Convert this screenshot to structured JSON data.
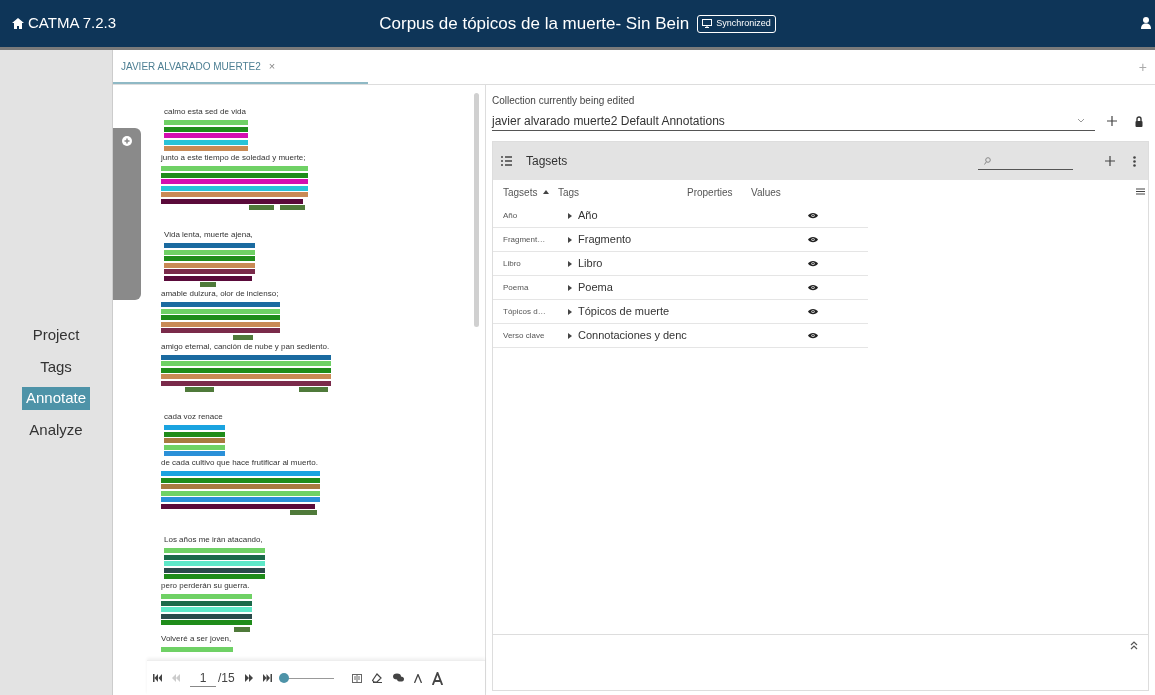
{
  "app": {
    "name": "CATMA 7.2.3",
    "project_title": "Corpus de tópicos de la muerte- Sin Bein",
    "sync_badge": "Synchronized"
  },
  "nav": [
    {
      "label": "Project",
      "selected": false
    },
    {
      "label": "Tags",
      "selected": false
    },
    {
      "label": "Annotate",
      "selected": true
    },
    {
      "label": "Analyze",
      "selected": false
    }
  ],
  "document_tab": {
    "label": "JAVIER ALVARADO MUERTE2",
    "close": "×",
    "add": "+"
  },
  "stanzas": [
    {
      "lines": [
        {
          "text": "calmo esta sed de vida",
          "layers": [
            {
              "kind": "full",
              "color": "#6fd165"
            },
            {
              "kind": "full",
              "color": "#1f8c1a"
            },
            {
              "kind": "full",
              "color": "#d40fb0"
            },
            {
              "kind": "full",
              "color": "#28c3d8"
            },
            {
              "kind": "full",
              "color": "#c98a55"
            }
          ]
        },
        {
          "text": "junto a este tiempo de soledad y muerte;",
          "layers": [
            {
              "kind": "full",
              "color": "#6fd165"
            },
            {
              "kind": "full",
              "color": "#1f8c1a"
            },
            {
              "kind": "full",
              "color": "#d40fb0"
            },
            {
              "kind": "full",
              "color": "#28c3d8"
            },
            {
              "kind": "full",
              "color": "#c98a55"
            },
            {
              "kind": "short",
              "color": "#5a0a3a"
            },
            {
              "kind": "mark-mid",
              "color": "#4f7a3a"
            },
            {
              "kind": "mark-end",
              "color": "#4f7a3a"
            }
          ]
        }
      ]
    },
    {
      "lines": [
        {
          "text": "Vida lenta, muerte ajena,",
          "layers": [
            {
              "kind": "full",
              "color": "#1a6aa0"
            },
            {
              "kind": "full",
              "color": "#6fd165"
            },
            {
              "kind": "full",
              "color": "#1f8c1a"
            },
            {
              "kind": "full",
              "color": "#c98a55"
            },
            {
              "kind": "full",
              "color": "#7a2a4a"
            },
            {
              "kind": "short",
              "color": "#5a0a3a"
            },
            {
              "kind": "mark-center",
              "color": "#4f7a3a"
            }
          ]
        },
        {
          "text": "amable dulzura, olor de incienso;",
          "layers": [
            {
              "kind": "full",
              "color": "#1a6aa0"
            },
            {
              "kind": "full",
              "color": "#6fd165"
            },
            {
              "kind": "full",
              "color": "#1f8c1a"
            },
            {
              "kind": "full",
              "color": "#c98a55"
            },
            {
              "kind": "full",
              "color": "#7a2a4a"
            },
            {
              "kind": "mark-mid",
              "color": "#4f7a3a"
            }
          ]
        },
        {
          "text": "amigo eternal, canción de nube y pan sediento.",
          "layers": [
            {
              "kind": "full",
              "color": "#1a6aa0"
            },
            {
              "kind": "full",
              "color": "#6fd165"
            },
            {
              "kind": "full",
              "color": "#1f8c1a"
            },
            {
              "kind": "full",
              "color": "#c98a55"
            },
            {
              "kind": "full",
              "color": "#7a2a4a"
            },
            {
              "kind": "mark-start",
              "color": "#4f7a3a"
            },
            {
              "kind": "mark-end",
              "color": "#4f7a3a"
            }
          ]
        }
      ]
    },
    {
      "lines": [
        {
          "text": "cada voz renace",
          "layers": [
            {
              "kind": "full",
              "color": "#1aa3e0"
            },
            {
              "kind": "full",
              "color": "#1f8c1a"
            },
            {
              "kind": "full",
              "color": "#a87a40"
            },
            {
              "kind": "full",
              "color": "#6fd165"
            },
            {
              "kind": "full",
              "color": "#2a90d8"
            }
          ]
        },
        {
          "text": "de cada cultivo que hace frutificar al muerto.",
          "layers": [
            {
              "kind": "full",
              "color": "#1aa3e0"
            },
            {
              "kind": "full",
              "color": "#1f8c1a"
            },
            {
              "kind": "full",
              "color": "#a87a40"
            },
            {
              "kind": "full",
              "color": "#6fd165"
            },
            {
              "kind": "full",
              "color": "#2a90d8"
            },
            {
              "kind": "short",
              "color": "#5a0a3a"
            },
            {
              "kind": "mark-end",
              "color": "#4f7a3a"
            }
          ]
        }
      ]
    },
    {
      "lines": [
        {
          "text": "Los años me irán atacando,",
          "layers": [
            {
              "kind": "full",
              "color": "#6fd165"
            },
            {
              "kind": "full",
              "color": "#1a6a4a"
            },
            {
              "kind": "full",
              "color": "#5ee8c8"
            },
            {
              "kind": "full",
              "color": "#2a4a4a"
            },
            {
              "kind": "full",
              "color": "#1f8c1a"
            }
          ]
        },
        {
          "text": "pero perderán su guerra.",
          "layers": [
            {
              "kind": "full",
              "color": "#6fd165"
            },
            {
              "kind": "full",
              "color": "#1a6a4a"
            },
            {
              "kind": "full",
              "color": "#5ee8c8"
            },
            {
              "kind": "full",
              "color": "#2a4a4a"
            },
            {
              "kind": "full",
              "color": "#1f8c1a"
            },
            {
              "kind": "mark-end",
              "color": "#4f7a3a"
            }
          ]
        },
        {
          "text": "Volveré a ser joven,",
          "layers": [
            {
              "kind": "full",
              "color": "#6fd165"
            }
          ]
        }
      ]
    }
  ],
  "pager": {
    "page": "1",
    "total": "/15",
    "zoom": {
      "level": 0.05
    },
    "prev_disabled": true
  },
  "collection": {
    "label": "Collection currently being edited",
    "value": "javier alvarado muerte2 Default Annotations"
  },
  "tagsets": {
    "title": "Tagsets",
    "columns": [
      "Tagsets",
      "Tags",
      "Properties",
      "Values"
    ],
    "rows": [
      {
        "tagset": "Año",
        "tag": "Año",
        "visible": true
      },
      {
        "tagset": "Fragment…",
        "tag": "Fragmento",
        "visible": true
      },
      {
        "tagset": "Libro",
        "tag": "Libro",
        "visible": true
      },
      {
        "tagset": "Poema",
        "tag": "Poema",
        "visible": true
      },
      {
        "tagset": "Tópicos d…",
        "tag": "Tópicos de muerte",
        "visible": true
      },
      {
        "tagset": "Verso clave",
        "tag": "Connotaciones y denc",
        "visible": true
      }
    ]
  }
}
